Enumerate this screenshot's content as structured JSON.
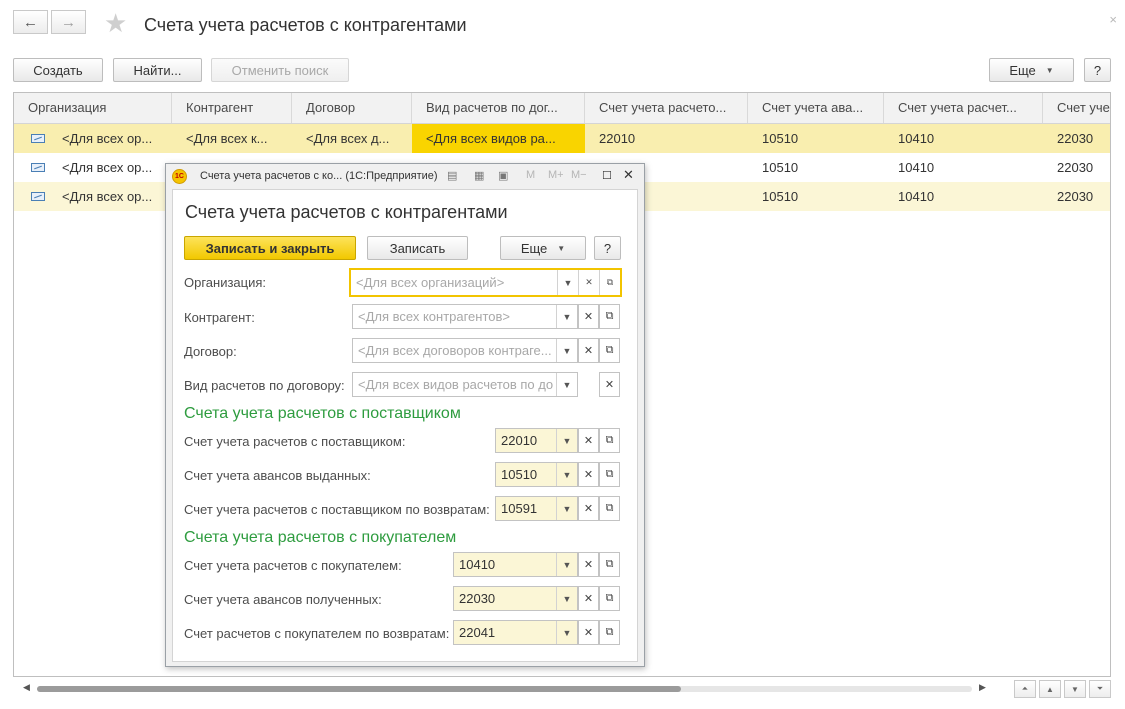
{
  "header": {
    "back_icon": "←",
    "forward_icon": "→",
    "star_icon": "★",
    "title": "Счета учета расчетов с контрагентами",
    "close_icon": "×"
  },
  "toolbar": {
    "create": "Создать",
    "find": "Найти...",
    "cancel_search": "Отменить поиск",
    "more": "Еще",
    "help": "?"
  },
  "grid": {
    "columns": [
      "Организация",
      "Контрагент",
      "Договор",
      "Вид расчетов по дог...",
      "Счет учета расчето...",
      "Счет учета ава...",
      "Счет учета расчет...",
      "Счет уче"
    ],
    "rows": [
      {
        "org": "<Для всех ор...",
        "contr": "<Для всех к...",
        "dog": "<Для всех д...",
        "vid": "<Для всех видов ра...",
        "c1": "22010",
        "c2": "10510",
        "c3": "10410",
        "c4": "22030"
      },
      {
        "org": "<Для всех ор...",
        "contr": "",
        "dog": "",
        "vid": "",
        "c1": "",
        "c2": "10510",
        "c3": "10410",
        "c4": "22030"
      },
      {
        "org": "<Для всех ор...",
        "contr": "",
        "dog": "",
        "vid": "",
        "c1": "",
        "c2": "10510",
        "c3": "10410",
        "c4": "22030"
      }
    ]
  },
  "modal": {
    "logo": "1С",
    "titlebar": "Счета учета расчетов с ко...  (1С:Предприятие)",
    "heading": "Счета учета расчетов с контрагентами",
    "save_close": "Записать и закрыть",
    "save": "Записать",
    "more": "Еще",
    "help": "?",
    "fields": {
      "org_label": "Организация:",
      "org_ph": "<Для всех организаций>",
      "contr_label": "Контрагент:",
      "contr_ph": "<Для всех контрагентов>",
      "dog_label": "Договор:",
      "dog_ph": "<Для всех договоров контраге...",
      "vid_label": "Вид расчетов по договору:",
      "vid_ph": "<Для всех видов расчетов по дог..."
    },
    "supplier": {
      "title": "Счета учета расчетов с поставщиком",
      "l1": "Счет учета расчетов с поставщиком:",
      "v1": "22010",
      "l2": "Счет учета авансов выданных:",
      "v2": "10510",
      "l3": "Счет учета расчетов с поставщиком по возвратам:",
      "v3": "10591"
    },
    "buyer": {
      "title": "Счета учета расчетов с покупателем",
      "l1": "Счет учета расчетов с покупателем:",
      "v1": "10410",
      "l2": "Счет учета авансов полученных:",
      "v2": "22030",
      "l3": "Счет расчетов с покупателем по возвратам:",
      "v3": "22041"
    }
  }
}
